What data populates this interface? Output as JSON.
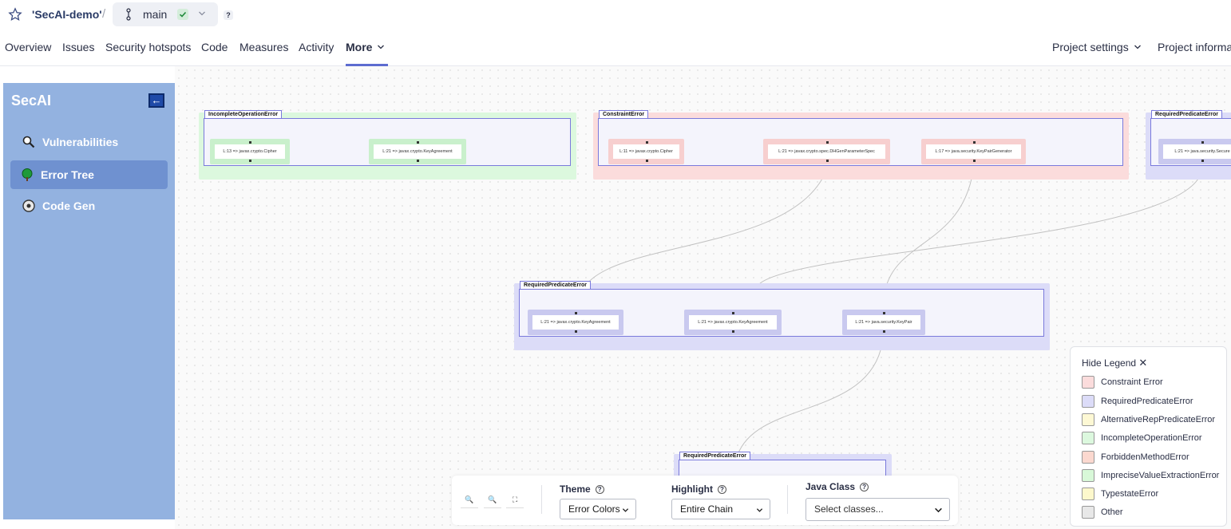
{
  "header": {
    "project": "'SecAI-demo'",
    "separator": "/",
    "branch": "main",
    "help": "?"
  },
  "nav": {
    "overview": "Overview",
    "issues": "Issues",
    "security_hotspots": "Security hotspots",
    "code": "Code",
    "measures": "Measures",
    "activity": "Activity",
    "more": "More",
    "project_settings": "Project settings",
    "project_information": "Project informat"
  },
  "sidebar": {
    "title": "SecAI",
    "collapse_icon": "←",
    "items": [
      {
        "label": "Vulnerabilities",
        "icon": "magnifier-icon"
      },
      {
        "label": "Error Tree",
        "icon": "tree-icon"
      },
      {
        "label": "Code Gen",
        "icon": "gear-icon"
      }
    ]
  },
  "graph": {
    "groups": [
      {
        "title": "IncompleteOperationError",
        "nodes": [
          "L:13 => javax.crypto.Cipher",
          "L:21 => javax.crypto.KeyAgreement"
        ]
      },
      {
        "title": "ConstraintError",
        "nodes": [
          "L:11 => javax.crypto.Cipher",
          "L:21 => javax.crypto.spec.DHGenParameterSpec",
          "L:17 => java.security.KeyPairGenerator"
        ]
      },
      {
        "title": "RequiredPredicateError",
        "nodes": [
          "L:21 => java.security.Secure"
        ]
      },
      {
        "title": "RequiredPredicateError",
        "nodes": [
          "L:21 => javax.crypto.KeyAgreement",
          "L:21 => javax.crypto.KeyAgreement",
          "L:21 => java.security.KeyPair"
        ]
      },
      {
        "title": "RequiredPredicateError",
        "nodes": []
      }
    ]
  },
  "toolbar": {
    "zoom_in": "🔍",
    "zoom_out": "🔍",
    "fit": "⛶",
    "theme_label": "Theme",
    "theme_value": "Error Colors",
    "highlight_label": "Highlight",
    "highlight_value": "Entire Chain",
    "java_class_label": "Java Class",
    "java_class_placeholder": "Select classes...",
    "help": "?"
  },
  "legend": {
    "header": "Hide Legend",
    "close": "✕",
    "items": [
      {
        "label": "Constraint Error",
        "color": "#fbdcdc"
      },
      {
        "label": "RequiredPredicateError",
        "color": "#dcdcf8"
      },
      {
        "label": "AlternativeRepPredicateError",
        "color": "#fdf8d4"
      },
      {
        "label": "IncompleteOperationError",
        "color": "#dcf8de"
      },
      {
        "label": "ForbiddenMethodError",
        "color": "#fbd8cf"
      },
      {
        "label": "ImpreciseValueExtractionError",
        "color": "#d8f8d8"
      },
      {
        "label": "TypestateError",
        "color": "#fdf8cc"
      },
      {
        "label": "Other",
        "color": "#e8e8e8"
      }
    ]
  },
  "colors": {
    "sidebar": "#93b2e0",
    "accent": "#5d6cd0"
  }
}
